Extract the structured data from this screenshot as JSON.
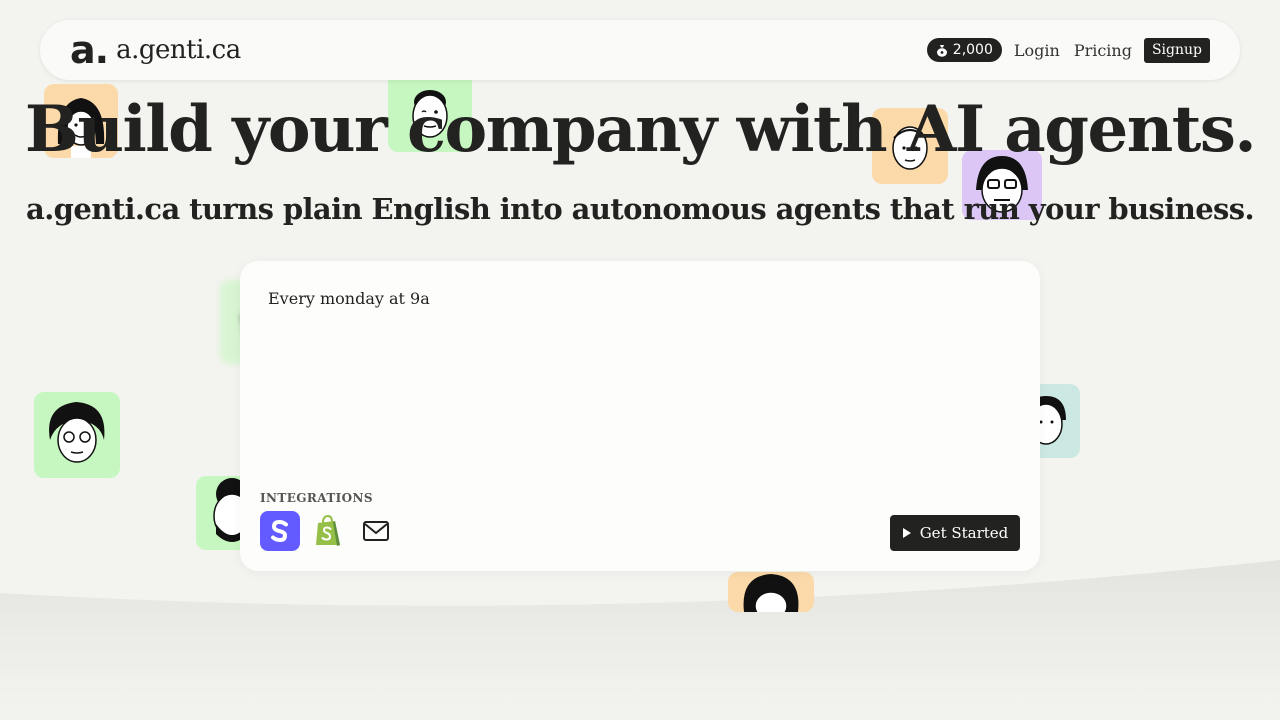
{
  "header": {
    "logo_mark": "a.",
    "brand_name": "a.genti.ca",
    "credits_icon": "money-bag-icon",
    "credits": "2,000",
    "login": "Login",
    "pricing": "Pricing",
    "signup": "Signup"
  },
  "hero": {
    "headline": "Build your company with AI agents.",
    "subline": "a.genti.ca turns plain English into autonomous agents that run your business."
  },
  "card": {
    "prompt_value": "Every monday at 9a",
    "integrations_label": "INTEGRATIONS",
    "integrations": [
      "stripe-icon",
      "shopify-icon",
      "mail-icon"
    ],
    "get_started": "Get Started"
  },
  "colors": {
    "background": "#f3f3ef",
    "dark": "#222220",
    "stripe": "#635bff",
    "shopify": "#95bf47",
    "avatar_orange": "#fcd9a8",
    "avatar_green": "#c7f7c0",
    "avatar_purple": "#dcc6f5",
    "avatar_teal": "#cce8e2"
  }
}
